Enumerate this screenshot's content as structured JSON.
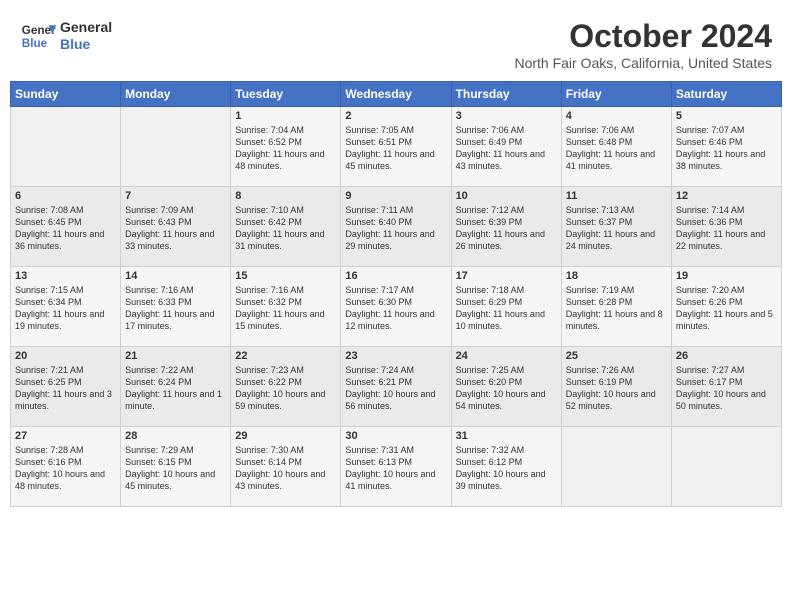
{
  "header": {
    "logo_line1": "General",
    "logo_line2": "Blue",
    "month": "October 2024",
    "location": "North Fair Oaks, California, United States"
  },
  "weekdays": [
    "Sunday",
    "Monday",
    "Tuesday",
    "Wednesday",
    "Thursday",
    "Friday",
    "Saturday"
  ],
  "weeks": [
    [
      {
        "day": "",
        "info": ""
      },
      {
        "day": "",
        "info": ""
      },
      {
        "day": "1",
        "info": "Sunrise: 7:04 AM\nSunset: 6:52 PM\nDaylight: 11 hours and 48 minutes."
      },
      {
        "day": "2",
        "info": "Sunrise: 7:05 AM\nSunset: 6:51 PM\nDaylight: 11 hours and 45 minutes."
      },
      {
        "day": "3",
        "info": "Sunrise: 7:06 AM\nSunset: 6:49 PM\nDaylight: 11 hours and 43 minutes."
      },
      {
        "day": "4",
        "info": "Sunrise: 7:06 AM\nSunset: 6:48 PM\nDaylight: 11 hours and 41 minutes."
      },
      {
        "day": "5",
        "info": "Sunrise: 7:07 AM\nSunset: 6:46 PM\nDaylight: 11 hours and 38 minutes."
      }
    ],
    [
      {
        "day": "6",
        "info": "Sunrise: 7:08 AM\nSunset: 6:45 PM\nDaylight: 11 hours and 36 minutes."
      },
      {
        "day": "7",
        "info": "Sunrise: 7:09 AM\nSunset: 6:43 PM\nDaylight: 11 hours and 33 minutes."
      },
      {
        "day": "8",
        "info": "Sunrise: 7:10 AM\nSunset: 6:42 PM\nDaylight: 11 hours and 31 minutes."
      },
      {
        "day": "9",
        "info": "Sunrise: 7:11 AM\nSunset: 6:40 PM\nDaylight: 11 hours and 29 minutes."
      },
      {
        "day": "10",
        "info": "Sunrise: 7:12 AM\nSunset: 6:39 PM\nDaylight: 11 hours and 26 minutes."
      },
      {
        "day": "11",
        "info": "Sunrise: 7:13 AM\nSunset: 6:37 PM\nDaylight: 11 hours and 24 minutes."
      },
      {
        "day": "12",
        "info": "Sunrise: 7:14 AM\nSunset: 6:36 PM\nDaylight: 11 hours and 22 minutes."
      }
    ],
    [
      {
        "day": "13",
        "info": "Sunrise: 7:15 AM\nSunset: 6:34 PM\nDaylight: 11 hours and 19 minutes."
      },
      {
        "day": "14",
        "info": "Sunrise: 7:16 AM\nSunset: 6:33 PM\nDaylight: 11 hours and 17 minutes."
      },
      {
        "day": "15",
        "info": "Sunrise: 7:16 AM\nSunset: 6:32 PM\nDaylight: 11 hours and 15 minutes."
      },
      {
        "day": "16",
        "info": "Sunrise: 7:17 AM\nSunset: 6:30 PM\nDaylight: 11 hours and 12 minutes."
      },
      {
        "day": "17",
        "info": "Sunrise: 7:18 AM\nSunset: 6:29 PM\nDaylight: 11 hours and 10 minutes."
      },
      {
        "day": "18",
        "info": "Sunrise: 7:19 AM\nSunset: 6:28 PM\nDaylight: 11 hours and 8 minutes."
      },
      {
        "day": "19",
        "info": "Sunrise: 7:20 AM\nSunset: 6:26 PM\nDaylight: 11 hours and 5 minutes."
      }
    ],
    [
      {
        "day": "20",
        "info": "Sunrise: 7:21 AM\nSunset: 6:25 PM\nDaylight: 11 hours and 3 minutes."
      },
      {
        "day": "21",
        "info": "Sunrise: 7:22 AM\nSunset: 6:24 PM\nDaylight: 11 hours and 1 minute."
      },
      {
        "day": "22",
        "info": "Sunrise: 7:23 AM\nSunset: 6:22 PM\nDaylight: 10 hours and 59 minutes."
      },
      {
        "day": "23",
        "info": "Sunrise: 7:24 AM\nSunset: 6:21 PM\nDaylight: 10 hours and 56 minutes."
      },
      {
        "day": "24",
        "info": "Sunrise: 7:25 AM\nSunset: 6:20 PM\nDaylight: 10 hours and 54 minutes."
      },
      {
        "day": "25",
        "info": "Sunrise: 7:26 AM\nSunset: 6:19 PM\nDaylight: 10 hours and 52 minutes."
      },
      {
        "day": "26",
        "info": "Sunrise: 7:27 AM\nSunset: 6:17 PM\nDaylight: 10 hours and 50 minutes."
      }
    ],
    [
      {
        "day": "27",
        "info": "Sunrise: 7:28 AM\nSunset: 6:16 PM\nDaylight: 10 hours and 48 minutes."
      },
      {
        "day": "28",
        "info": "Sunrise: 7:29 AM\nSunset: 6:15 PM\nDaylight: 10 hours and 45 minutes."
      },
      {
        "day": "29",
        "info": "Sunrise: 7:30 AM\nSunset: 6:14 PM\nDaylight: 10 hours and 43 minutes."
      },
      {
        "day": "30",
        "info": "Sunrise: 7:31 AM\nSunset: 6:13 PM\nDaylight: 10 hours and 41 minutes."
      },
      {
        "day": "31",
        "info": "Sunrise: 7:32 AM\nSunset: 6:12 PM\nDaylight: 10 hours and 39 minutes."
      },
      {
        "day": "",
        "info": ""
      },
      {
        "day": "",
        "info": ""
      }
    ]
  ]
}
